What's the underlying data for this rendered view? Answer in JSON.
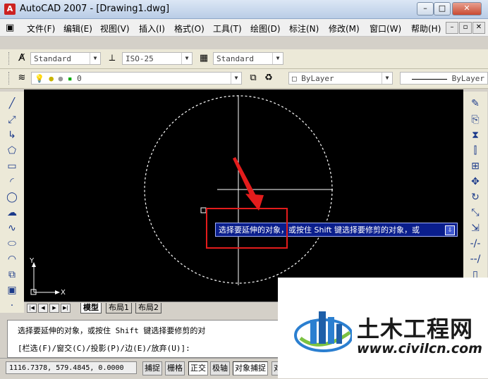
{
  "window": {
    "title": "AutoCAD 2007 - [Drawing1.dwg]",
    "min": "–",
    "restore": "□",
    "close": "✕"
  },
  "menu": [
    "文件(F)",
    "编辑(E)",
    "视图(V)",
    "插入(I)",
    "格式(O)",
    "工具(T)",
    "绘图(D)",
    "标注(N)",
    "修改(M)",
    "窗口(W)",
    "帮助(H)"
  ],
  "styles": {
    "text_style": "Standard",
    "dim_style": "ISO-25",
    "table_style": "Standard"
  },
  "layers": {
    "current_layer": "0",
    "color": "ByLayer",
    "linetype": "ByLayer"
  },
  "canvas": {
    "ucs_y": "Y",
    "ucs_x": "X",
    "tooltip": "选择要延伸的对象，或按住 Shift 键选择要修剪的对象，或"
  },
  "tabs": [
    "模型",
    "布局1",
    "布局2"
  ],
  "command": {
    "line1": "选择要延伸的对象，或按住 Shift 键选择要修剪的对",
    "line2": "[栏选(F)/窗交(C)/投影(P)/边(E)/放弃(U)]:"
  },
  "status": {
    "coords": "1116.7378, 579.4845, 0.0000",
    "buttons": [
      "捕捉",
      "栅格",
      "正交",
      "极轴",
      "对象捕捉",
      "对"
    ]
  },
  "watermark": {
    "title": "土木工程网",
    "url": "www.civilcn.com"
  },
  "colors": {
    "canvas_bg": "#000000",
    "tooltip_bg": "#0a1e8c",
    "highlight": "#e31c1c"
  }
}
